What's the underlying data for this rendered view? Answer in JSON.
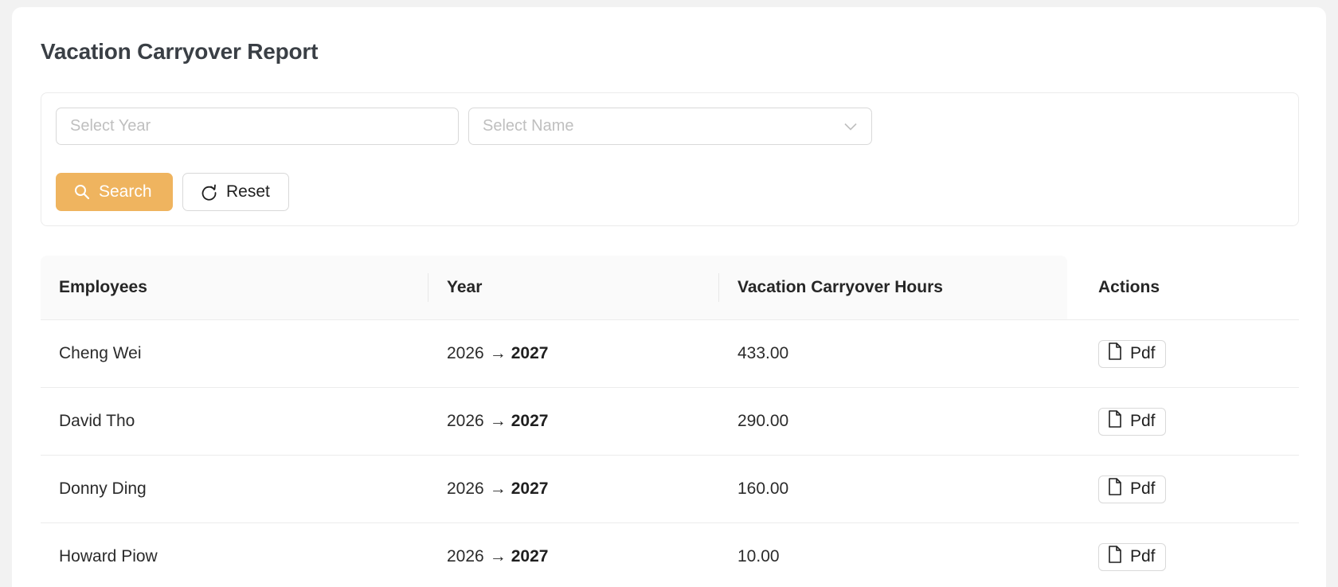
{
  "page": {
    "title": "Vacation Carryover Report"
  },
  "filters": {
    "year_placeholder": "Select Year",
    "name_placeholder": "Select Name",
    "search_label": "Search",
    "reset_label": "Reset"
  },
  "table": {
    "columns": [
      "Employees",
      "Year",
      "Vacation Carryover Hours",
      "Actions"
    ],
    "rows": [
      {
        "employee": "Cheng Wei",
        "year_from": "2026",
        "year_to": "2027",
        "hours": "433.00",
        "action": "Pdf"
      },
      {
        "employee": "David Tho",
        "year_from": "2026",
        "year_to": "2027",
        "hours": "290.00",
        "action": "Pdf"
      },
      {
        "employee": "Donny Ding",
        "year_from": "2026",
        "year_to": "2027",
        "hours": "160.00",
        "action": "Pdf"
      },
      {
        "employee": "Howard Piow",
        "year_from": "2026",
        "year_to": "2027",
        "hours": "10.00",
        "action": "Pdf"
      }
    ]
  },
  "theme": {
    "accent": "#efb45f",
    "border": "#d9d9d9",
    "header_bg": "#fafafa"
  },
  "icons": {
    "search": "search-icon",
    "reset": "reload-icon",
    "dropdown": "chevron-down-icon",
    "pdf": "file-icon"
  }
}
